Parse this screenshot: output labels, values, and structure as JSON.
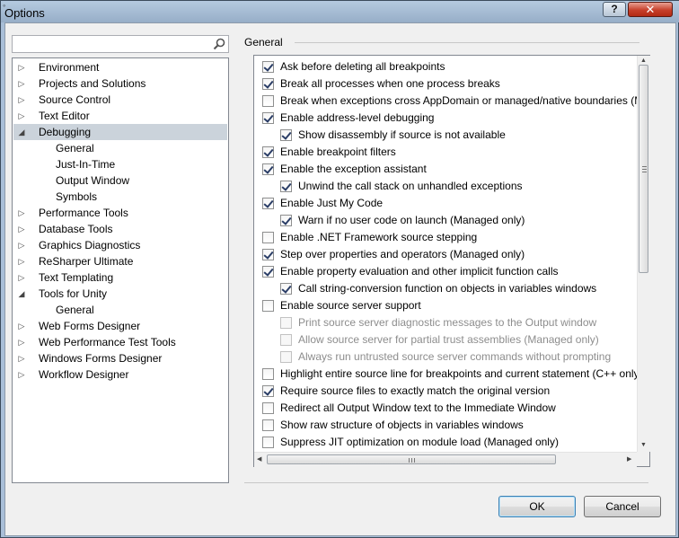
{
  "window": {
    "title": "Options",
    "help_glyph": "?",
    "close_glyph": "✕"
  },
  "search": {
    "value": "",
    "placeholder": "",
    "icon": "magnifier-icon"
  },
  "tree": [
    {
      "label": "Environment",
      "level": 0,
      "arrow": "▷"
    },
    {
      "label": "Projects and Solutions",
      "level": 0,
      "arrow": "▷"
    },
    {
      "label": "Source Control",
      "level": 0,
      "arrow": "▷"
    },
    {
      "label": "Text Editor",
      "level": 0,
      "arrow": "▷"
    },
    {
      "label": "Debugging",
      "level": 0,
      "arrow": "◢",
      "selected": true
    },
    {
      "label": "General",
      "level": 1,
      "arrow": ""
    },
    {
      "label": "Just-In-Time",
      "level": 1,
      "arrow": ""
    },
    {
      "label": "Output Window",
      "level": 1,
      "arrow": ""
    },
    {
      "label": "Symbols",
      "level": 1,
      "arrow": ""
    },
    {
      "label": "Performance Tools",
      "level": 0,
      "arrow": "▷"
    },
    {
      "label": "Database Tools",
      "level": 0,
      "arrow": "▷"
    },
    {
      "label": "Graphics Diagnostics",
      "level": 0,
      "arrow": "▷"
    },
    {
      "label": "ReSharper Ultimate",
      "level": 0,
      "arrow": "▷"
    },
    {
      "label": "Text Templating",
      "level": 0,
      "arrow": "▷"
    },
    {
      "label": "Tools for Unity",
      "level": 0,
      "arrow": "◢"
    },
    {
      "label": "General",
      "level": 1,
      "arrow": ""
    },
    {
      "label": "Web Forms Designer",
      "level": 0,
      "arrow": "▷"
    },
    {
      "label": "Web Performance Test Tools",
      "level": 0,
      "arrow": "▷"
    },
    {
      "label": "Windows Forms Designer",
      "level": 0,
      "arrow": "▷"
    },
    {
      "label": "Workflow Designer",
      "level": 0,
      "arrow": "▷"
    }
  ],
  "section": {
    "title": "General"
  },
  "options": [
    {
      "label": "Ask before deleting all breakpoints",
      "checked": true,
      "level": 0
    },
    {
      "label": "Break all processes when one process breaks",
      "checked": true,
      "level": 0
    },
    {
      "label": "Break when exceptions cross AppDomain or managed/native boundaries (M",
      "checked": false,
      "level": 0
    },
    {
      "label": "Enable address-level debugging",
      "checked": true,
      "level": 0
    },
    {
      "label": "Show disassembly if source is not available",
      "checked": true,
      "level": 1
    },
    {
      "label": "Enable breakpoint filters",
      "checked": true,
      "level": 0
    },
    {
      "label": "Enable the exception assistant",
      "checked": true,
      "level": 0
    },
    {
      "label": "Unwind the call stack on unhandled exceptions",
      "checked": true,
      "level": 1
    },
    {
      "label": "Enable Just My Code",
      "checked": true,
      "level": 0
    },
    {
      "label": "Warn if no user code on launch (Managed only)",
      "checked": true,
      "level": 1
    },
    {
      "label": "Enable .NET Framework source stepping",
      "checked": false,
      "level": 0
    },
    {
      "label": "Step over properties and operators (Managed only)",
      "checked": true,
      "level": 0
    },
    {
      "label": "Enable property evaluation and other implicit function calls",
      "checked": true,
      "level": 0
    },
    {
      "label": "Call string-conversion function on objects in variables windows",
      "checked": true,
      "level": 1
    },
    {
      "label": "Enable source server support",
      "checked": false,
      "level": 0
    },
    {
      "label": "Print source server diagnostic messages to the Output window",
      "checked": false,
      "level": 1,
      "disabled": true
    },
    {
      "label": "Allow source server for partial trust assemblies (Managed only)",
      "checked": false,
      "level": 1,
      "disabled": true
    },
    {
      "label": "Always run untrusted source server commands without prompting",
      "checked": false,
      "level": 1,
      "disabled": true
    },
    {
      "label": "Highlight entire source line for breakpoints and current statement (C++ only",
      "checked": false,
      "level": 0
    },
    {
      "label": "Require source files to exactly match the original version",
      "checked": true,
      "level": 0
    },
    {
      "label": "Redirect all Output Window text to the Immediate Window",
      "checked": false,
      "level": 0
    },
    {
      "label": "Show raw structure of objects in variables windows",
      "checked": false,
      "level": 0
    },
    {
      "label": "Suppress JIT optimization on module load (Managed only)",
      "checked": false,
      "level": 0
    }
  ],
  "buttons": {
    "ok": "OK",
    "cancel": "Cancel"
  }
}
